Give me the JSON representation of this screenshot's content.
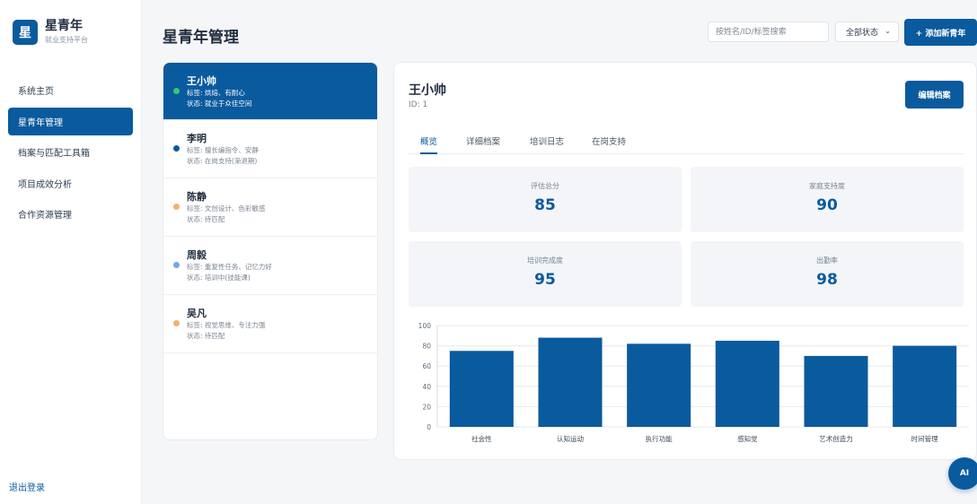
{
  "brand": {
    "logo": "星",
    "name": "星青年",
    "subtitle": "就业支持平台"
  },
  "nav": {
    "items": [
      {
        "label": "系统主页",
        "active": false
      },
      {
        "label": "星青年管理",
        "active": true
      },
      {
        "label": "档案与匹配工具箱",
        "active": false
      },
      {
        "label": "项目成效分析",
        "active": false
      },
      {
        "label": "合作资源管理",
        "active": false
      }
    ],
    "logout": "退出登录"
  },
  "header": {
    "title": "星青年管理",
    "search_placeholder": "按姓名/ID/标签搜索",
    "status_filter": "全部状态",
    "add_button": "+ 添加新青年"
  },
  "youth_list": [
    {
      "name": "王小帅",
      "tags": "标签: 烘焙、有耐心",
      "status": "状态: 就业于众佳空间",
      "dot_color": "#2ecc71",
      "active": true
    },
    {
      "name": "李明",
      "tags": "标签: 擅长编指令、安静",
      "status": "状态: 在岗支持(渐退期)",
      "dot_color": "#0a5a9e",
      "active": false
    },
    {
      "name": "陈静",
      "tags": "标签: 文创设计、色彩敏感",
      "status": "状态: 待匹配",
      "dot_color": "#f5b06b",
      "active": false
    },
    {
      "name": "周毅",
      "tags": "标签: 重复性任务、记忆力好",
      "status": "状态: 培训中(技能课)",
      "dot_color": "#6fa8e8",
      "active": false
    },
    {
      "name": "吴凡",
      "tags": "标签: 视觉思维、专注力强",
      "status": "状态: 待匹配",
      "dot_color": "#f5b06b",
      "active": false
    }
  ],
  "detail": {
    "name": "王小帅",
    "id": "ID: 1",
    "edit_button": "编辑档案",
    "tabs": [
      {
        "label": "概览",
        "active": true
      },
      {
        "label": "详细档案",
        "active": false
      },
      {
        "label": "培训日志",
        "active": false
      },
      {
        "label": "在岗支持",
        "active": false
      }
    ],
    "stats": [
      {
        "label": "评估总分",
        "value": "85"
      },
      {
        "label": "家庭支持度",
        "value": "90"
      },
      {
        "label": "培训完成度",
        "value": "95"
      },
      {
        "label": "出勤率",
        "value": "98"
      }
    ]
  },
  "chart_data": {
    "type": "bar",
    "categories": [
      "社会性",
      "认知运动",
      "执行功能",
      "感知觉",
      "艺术创造力",
      "时间管理"
    ],
    "values": [
      75,
      88,
      82,
      85,
      70,
      80
    ],
    "ylim": [
      0,
      100
    ],
    "yticks": [
      0,
      20,
      40,
      60,
      80,
      100
    ],
    "grid": true,
    "bar_color": "#0a5a9e"
  },
  "ai_button": "AI"
}
